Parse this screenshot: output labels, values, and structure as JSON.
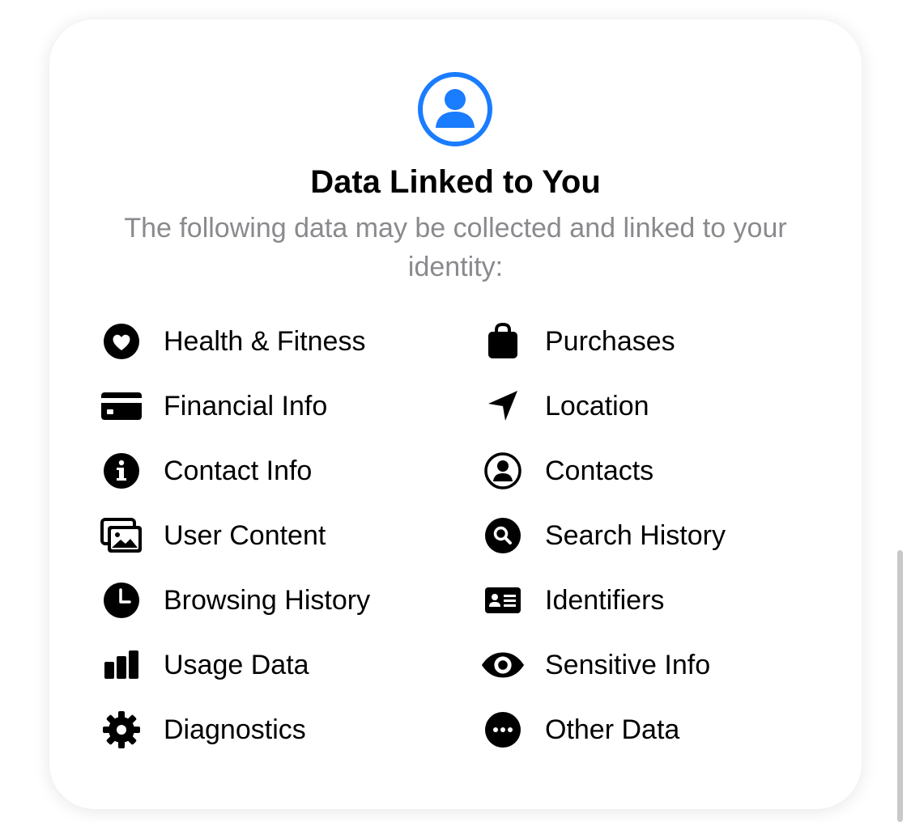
{
  "header": {
    "icon": "person-circle-icon",
    "title": "Data Linked to You",
    "subtitle": "The following data may be collected and linked to your identity:"
  },
  "colors": {
    "accent": "#1a7cff",
    "subtitle": "#8a8a8e",
    "text": "#000000"
  },
  "categories": {
    "left": [
      {
        "label": "Health & Fitness",
        "icon": "heart-icon"
      },
      {
        "label": "Financial Info",
        "icon": "credit-card-icon"
      },
      {
        "label": "Contact Info",
        "icon": "info-icon"
      },
      {
        "label": "User Content",
        "icon": "photos-icon"
      },
      {
        "label": "Browsing History",
        "icon": "clock-icon"
      },
      {
        "label": "Usage Data",
        "icon": "bar-chart-icon"
      },
      {
        "label": "Diagnostics",
        "icon": "gear-icon"
      }
    ],
    "right": [
      {
        "label": "Purchases",
        "icon": "shopping-bag-icon"
      },
      {
        "label": "Location",
        "icon": "location-arrow-icon"
      },
      {
        "label": "Contacts",
        "icon": "person-circle-icon"
      },
      {
        "label": "Search History",
        "icon": "search-icon"
      },
      {
        "label": "Identifiers",
        "icon": "id-card-icon"
      },
      {
        "label": "Sensitive Info",
        "icon": "eye-icon"
      },
      {
        "label": "Other Data",
        "icon": "ellipsis-icon"
      }
    ]
  }
}
